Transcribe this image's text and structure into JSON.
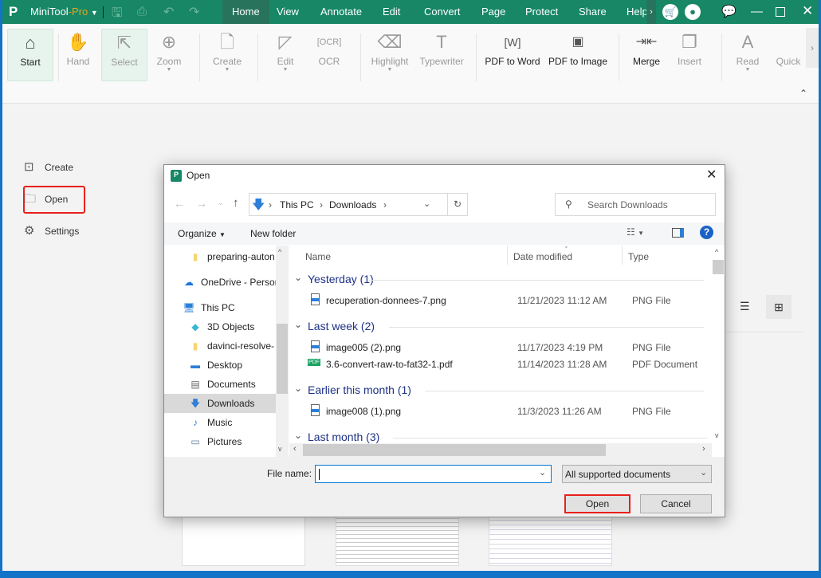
{
  "app": {
    "name": "MiniTool",
    "name_suffix": "-Pro",
    "brand_color": "#178766",
    "accent_color": "#e8a317"
  },
  "menu": [
    "Home",
    "View",
    "Annotate",
    "Edit",
    "Convert",
    "Page",
    "Protect",
    "Share",
    "Help"
  ],
  "ribbon": [
    {
      "label": "Start",
      "icon": "home-icon",
      "enabled": true,
      "selected": true
    },
    {
      "label": "Hand",
      "icon": "hand-icon",
      "enabled": false
    },
    {
      "label": "Select",
      "icon": "cursor-icon",
      "enabled": false,
      "selected": true
    },
    {
      "label": "Zoom",
      "icon": "zoom-icon",
      "enabled": false,
      "dropdown": true
    },
    {
      "label": "Create",
      "icon": "create-icon",
      "enabled": false,
      "dropdown": true
    },
    {
      "label": "Edit",
      "icon": "edit-icon",
      "enabled": false,
      "dropdown": true
    },
    {
      "label": "OCR",
      "icon": "ocr-icon",
      "enabled": false
    },
    {
      "label": "Highlight",
      "icon": "highlight-icon",
      "enabled": false,
      "dropdown": true
    },
    {
      "label": "Typewriter",
      "icon": "typewriter-icon",
      "enabled": false
    },
    {
      "label": "PDF to Word",
      "icon": "pdf-to-word-icon",
      "enabled": true
    },
    {
      "label": "PDF to Image",
      "icon": "pdf-to-image-icon",
      "enabled": true
    },
    {
      "label": "Merge",
      "icon": "merge-icon",
      "enabled": true
    },
    {
      "label": "Insert",
      "icon": "insert-icon",
      "enabled": false
    },
    {
      "label": "Read",
      "icon": "read-icon",
      "enabled": false,
      "dropdown": true
    },
    {
      "label": "Quick",
      "icon": "quick-icon",
      "enabled": false
    }
  ],
  "sidebar": [
    {
      "label": "Create",
      "icon": "create-icon"
    },
    {
      "label": "Open",
      "icon": "folder-icon",
      "highlighted": true
    },
    {
      "label": "Settings",
      "icon": "gear-icon"
    }
  ],
  "dialog": {
    "title": "Open",
    "path": [
      "This PC",
      "Downloads"
    ],
    "search_placeholder": "Search Downloads",
    "organize": "Organize",
    "new_folder": "New folder",
    "nav": [
      {
        "label": "preparing-auton",
        "icon": "folder-icon"
      },
      {
        "label": "OneDrive - Persor",
        "icon": "cloud-icon"
      },
      {
        "label": "This PC",
        "icon": "computer-icon"
      },
      {
        "label": "3D Objects",
        "icon": "cube-icon"
      },
      {
        "label": "davinci-resolve-",
        "icon": "folder-icon"
      },
      {
        "label": "Desktop",
        "icon": "desktop-icon"
      },
      {
        "label": "Documents",
        "icon": "documents-icon"
      },
      {
        "label": "Downloads",
        "icon": "download-icon",
        "selected": true
      },
      {
        "label": "Music",
        "icon": "music-icon"
      },
      {
        "label": "Pictures",
        "icon": "pictures-icon"
      }
    ],
    "columns": [
      "Name",
      "Date modified",
      "Type"
    ],
    "groups": [
      {
        "label": "Yesterday (1)",
        "files": [
          {
            "name": "recuperation-donnees-7.png",
            "date": "11/21/2023 11:12 AM",
            "type": "PNG File"
          }
        ]
      },
      {
        "label": "Last week (2)",
        "files": [
          {
            "name": "image005 (2).png",
            "date": "11/17/2023 4:19 PM",
            "type": "PNG File"
          },
          {
            "name": "3.6-convert-raw-to-fat32-1.pdf",
            "date": "11/14/2023 11:28 AM",
            "type": "PDF Document"
          }
        ]
      },
      {
        "label": "Earlier this month (1)",
        "files": [
          {
            "name": "image008 (1).png",
            "date": "11/3/2023 11:26 AM",
            "type": "PNG File"
          }
        ]
      },
      {
        "label": "Last month (3)",
        "files": []
      }
    ],
    "file_name_label": "File name:",
    "file_name_value": "",
    "filter": "All supported documents",
    "open_button": "Open",
    "cancel_button": "Cancel"
  }
}
